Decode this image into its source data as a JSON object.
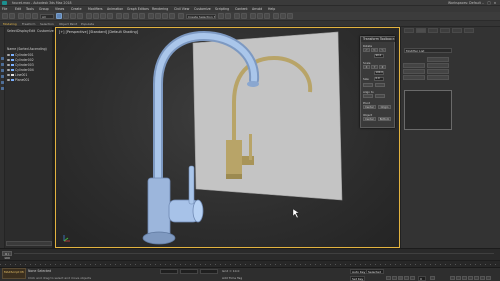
{
  "window": {
    "title": "faucet.max - Autodesk 3ds Max 2018",
    "workspace": "Workspaces: Default"
  },
  "menu": [
    "File",
    "Edit",
    "Tools",
    "Group",
    "Views",
    "Create",
    "Modifiers",
    "Animation",
    "Graph Editors",
    "Rendering",
    "Civil View",
    "Customize",
    "Scripting",
    "Content",
    "Arnold",
    "Help"
  ],
  "toolbar": {
    "selection_filter": "All",
    "named_selection": "Create Selection Set"
  },
  "ribbon": {
    "tabs": [
      "Modeling",
      "Freeform",
      "Selection",
      "Object Paint",
      "Populate"
    ]
  },
  "scene_explorer": {
    "tabs": [
      "Select",
      "Display",
      "Edit",
      "Customize"
    ],
    "header": "Name (Sorted Ascending)",
    "rows": [
      "Name (Sorted Ascending)",
      "Cylinder001",
      "Cylinder002",
      "Cylinder003",
      "Cylinder004",
      "Line001",
      "Plane001"
    ]
  },
  "viewport": {
    "label": "[+] [Perspective] [Standard] [Default Shading]",
    "colors": {
      "border": "#e3b33f",
      "faucet": "#aac6ea",
      "bg_plane": "#c4c4c4",
      "ghost_faucet": "#b8a468"
    }
  },
  "transform_toolbox": {
    "title": "Transform Toolbox",
    "rotate_label": "Rotate",
    "rotate_value": "90.0",
    "scale_label": "Scale",
    "scale_value": "100.0",
    "size_label": "Size",
    "size_value": "0.0",
    "align_label": "Align to",
    "pivot_label": "Pivot",
    "pivot_buttons": [
      "Center",
      "Origin"
    ],
    "object_label": "Object",
    "object_buttons": [
      "Center",
      "Bottom"
    ]
  },
  "command_panel": {
    "modifier_list": "Modifier List"
  },
  "timeline": {
    "frame": "0 / 100"
  },
  "status": {
    "selected": "None Selected",
    "hint": "Click and drag to select and move objects",
    "grid": "Grid = 10.0",
    "add_time_tag": "Add Time Tag",
    "auto_key": "Auto Key",
    "set_key": "Set Key",
    "selected_filter": "Selected",
    "frame_field": "0"
  },
  "maxscript": {
    "label": "MAXScript Mi"
  }
}
